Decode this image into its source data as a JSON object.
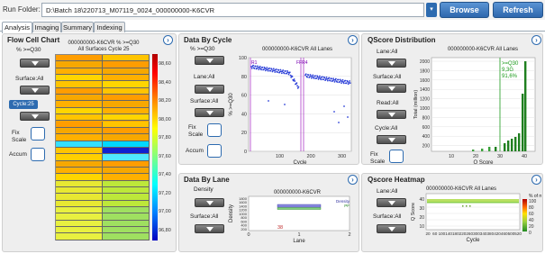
{
  "runfolder": {
    "label": "Run Folder:",
    "value": "D:\\Batch 18\\220713_M07119_0024_000000000-K6CVR"
  },
  "buttons": {
    "browse": "Browse",
    "refresh": "Refresh"
  },
  "tabs": [
    "Analysis",
    "Imaging",
    "Summary",
    "Indexing"
  ],
  "flowcell": {
    "title": "Flow Cell Chart",
    "metric": "% >=Q30",
    "surface": "Surface:All",
    "cycle": "Cycle:25",
    "fixscale": "Fix Scale",
    "accum": "Accum",
    "chart_title1": "000000000-K6CVR % >=Q30",
    "chart_title2": "All Surfaces Cycle 25",
    "scale_ticks": [
      "98,60",
      "98,40",
      "98,20",
      "98,00",
      "97,80",
      "97,60",
      "97,40",
      "97,20",
      "97,00",
      "96,80"
    ]
  },
  "bycycle": {
    "title": "Data By Cycle",
    "metric": "% >=Q30",
    "lane": "Lane:All",
    "surface": "Surface:All",
    "fixscale": "Fix Scale",
    "accum": "Accum",
    "chart_title": "000000000-K6CVR All Lanes",
    "ylabel": "% >=Q30",
    "xlabel": "Cycle",
    "yticks": [
      "100",
      "80",
      "60",
      "40",
      "20",
      "0"
    ],
    "xticks": [
      "100",
      "200",
      "300"
    ],
    "markers": [
      "R1",
      "FFR4"
    ]
  },
  "qscore": {
    "title": "QScore Distribution",
    "lane": "Lane:All",
    "surface": "Surface:All",
    "read": "Read:All",
    "cycle": "Cycle:All",
    "fixscale": "Fix Scale",
    "chart_title": "000000000-K6CVR All Lanes",
    "annotation": [
      ">=Q30",
      "9,3G",
      "91,6%"
    ],
    "ylabel": "Total (million)",
    "xlabel": "Q Score",
    "yticks": [
      "2000",
      "1800",
      "1600",
      "1400",
      "1200",
      "1000",
      "800",
      "600",
      "400",
      "200"
    ],
    "xticks": [
      "10",
      "20",
      "30",
      "40"
    ]
  },
  "bylane": {
    "title": "Data By Lane",
    "metric": "Density",
    "surface": "Surface:All",
    "chart_title": "000000000-K6CVR",
    "ylabel": "Density",
    "xlabel": "Lane",
    "yticks": [
      "1800",
      "1600",
      "1400",
      "1200",
      "1000",
      "800",
      "600",
      "400",
      "200"
    ],
    "xticks": [
      "0",
      "1",
      "2"
    ],
    "legend": [
      "Density",
      "PF"
    ],
    "value_label": "38"
  },
  "heatmap": {
    "title": "Qscore Heatmap",
    "lane": "Lane:All",
    "surface": "Surface:All",
    "chart_title": "000000000-K6CVR All Lanes",
    "ylabel": "Q Score",
    "xlabel": "Cycle",
    "yticks": [
      "40",
      "30",
      "20",
      "10"
    ],
    "xticks": [
      "20",
      "60",
      "100",
      "140",
      "180",
      "220",
      "260",
      "300",
      "340",
      "380",
      "420",
      "460",
      "500",
      "520"
    ],
    "scale_title": "% of max",
    "scale_ticks": [
      "100",
      "80",
      "60",
      "40",
      "20",
      "0"
    ]
  }
}
